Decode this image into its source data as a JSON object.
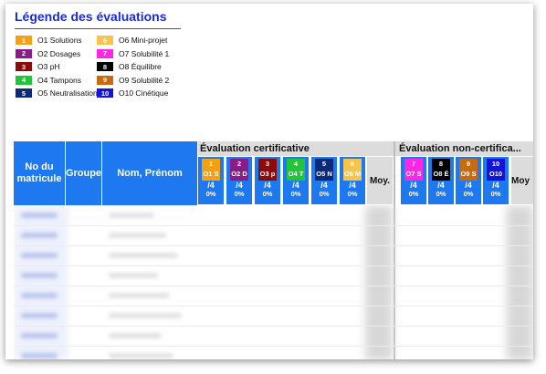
{
  "legend": {
    "title": "Légende des évaluations",
    "items": [
      {
        "num": "1",
        "label": "O1 Solutions",
        "color": "#f5a011"
      },
      {
        "num": "2",
        "label": "O2 Dosages",
        "color": "#8b1a8b"
      },
      {
        "num": "3",
        "label": "O3 pH",
        "color": "#8b0a0a"
      },
      {
        "num": "4",
        "label": "O4 Tampons",
        "color": "#22c53a"
      },
      {
        "num": "5",
        "label": "O5 Neutralisation",
        "color": "#0d2a7a"
      },
      {
        "num": "6",
        "label": "O6 Mini-projet",
        "color": "#f7c34a"
      },
      {
        "num": "7",
        "label": "O7 Solubilité 1",
        "color": "#ff26e8"
      },
      {
        "num": "8",
        "label": "O8 Équilibre",
        "color": "#000000"
      },
      {
        "num": "9",
        "label": "O9 Solubilité 2",
        "color": "#c86a10"
      },
      {
        "num": "10",
        "label": "O10 Cinétique",
        "color": "#1414d8"
      }
    ]
  },
  "table": {
    "col_matricule": "No du matricule",
    "col_groupe": "Groupe",
    "col_nom": "Nom, Prénom",
    "group_cert": "Évaluation certificative",
    "group_noncert": "Évaluation non-certifica...",
    "moy_label": "Moy.",
    "moy_label_2": "Moy",
    "cert_evals": [
      {
        "num": "1",
        "abbr": "O1 S",
        "pts": "/4",
        "pct": "0%",
        "color": "#f5a011"
      },
      {
        "num": "2",
        "abbr": "O2 D",
        "pts": "/4",
        "pct": "0%",
        "color": "#8b1a8b"
      },
      {
        "num": "3",
        "abbr": "O3 p",
        "pts": "/4",
        "pct": "0%",
        "color": "#8b0a0a"
      },
      {
        "num": "4",
        "abbr": "O4 T",
        "pts": "/4",
        "pct": "0%",
        "color": "#22c53a"
      },
      {
        "num": "5",
        "abbr": "O5 N",
        "pts": "/4",
        "pct": "0%",
        "color": "#0d2a7a"
      },
      {
        "num": "6",
        "abbr": "O6 M",
        "pts": "/4",
        "pct": "0%",
        "color": "#f7c34a"
      }
    ],
    "noncert_evals": [
      {
        "num": "7",
        "abbr": "O7 S",
        "pts": "/4",
        "pct": "0%",
        "color": "#ff26e8"
      },
      {
        "num": "8",
        "abbr": "O8 É",
        "pts": "/4",
        "pct": "0%",
        "color": "#000000"
      },
      {
        "num": "9",
        "abbr": "O9 S",
        "pts": "/4",
        "pct": "0%",
        "color": "#c86a10"
      },
      {
        "num": "10",
        "abbr": "O10",
        "pts": "/4",
        "pct": "0%",
        "color": "#1414d8"
      }
    ]
  }
}
